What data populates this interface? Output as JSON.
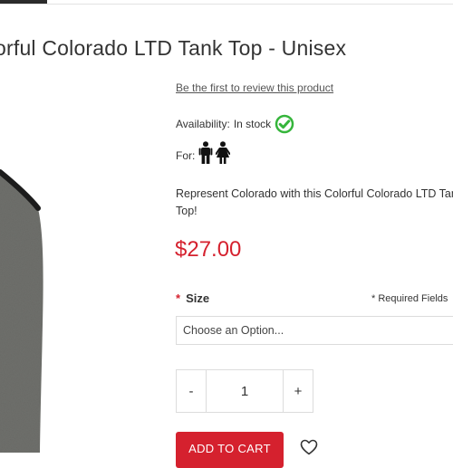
{
  "product": {
    "title": "orful Colorado LTD Tank Top - Unisex",
    "review_link": "Be the first to review this product",
    "availability_label": "Availability:",
    "availability_value": "In stock",
    "for_label": "For:",
    "description": "Represent Colorado with this Colorful Colorado LTD Tank Top!",
    "price": "$27.00"
  },
  "options": {
    "size_star": "*",
    "size_label": "Size",
    "required_note": "* Required Fields",
    "size_placeholder": "Choose an Option..."
  },
  "quantity": {
    "minus": "-",
    "value": "1",
    "plus": "+"
  },
  "actions": {
    "add_to_cart": "ADD TO CART"
  },
  "icons": {
    "availability": "check-circle-icon",
    "male": "male-icon",
    "female": "female-icon",
    "wishlist": "heart-icon"
  },
  "colors": {
    "accent": "#d5212e",
    "in_stock": "#35b53b",
    "shirt_body": "#6f706c",
    "shirt_trim": "#1c1c1c"
  }
}
